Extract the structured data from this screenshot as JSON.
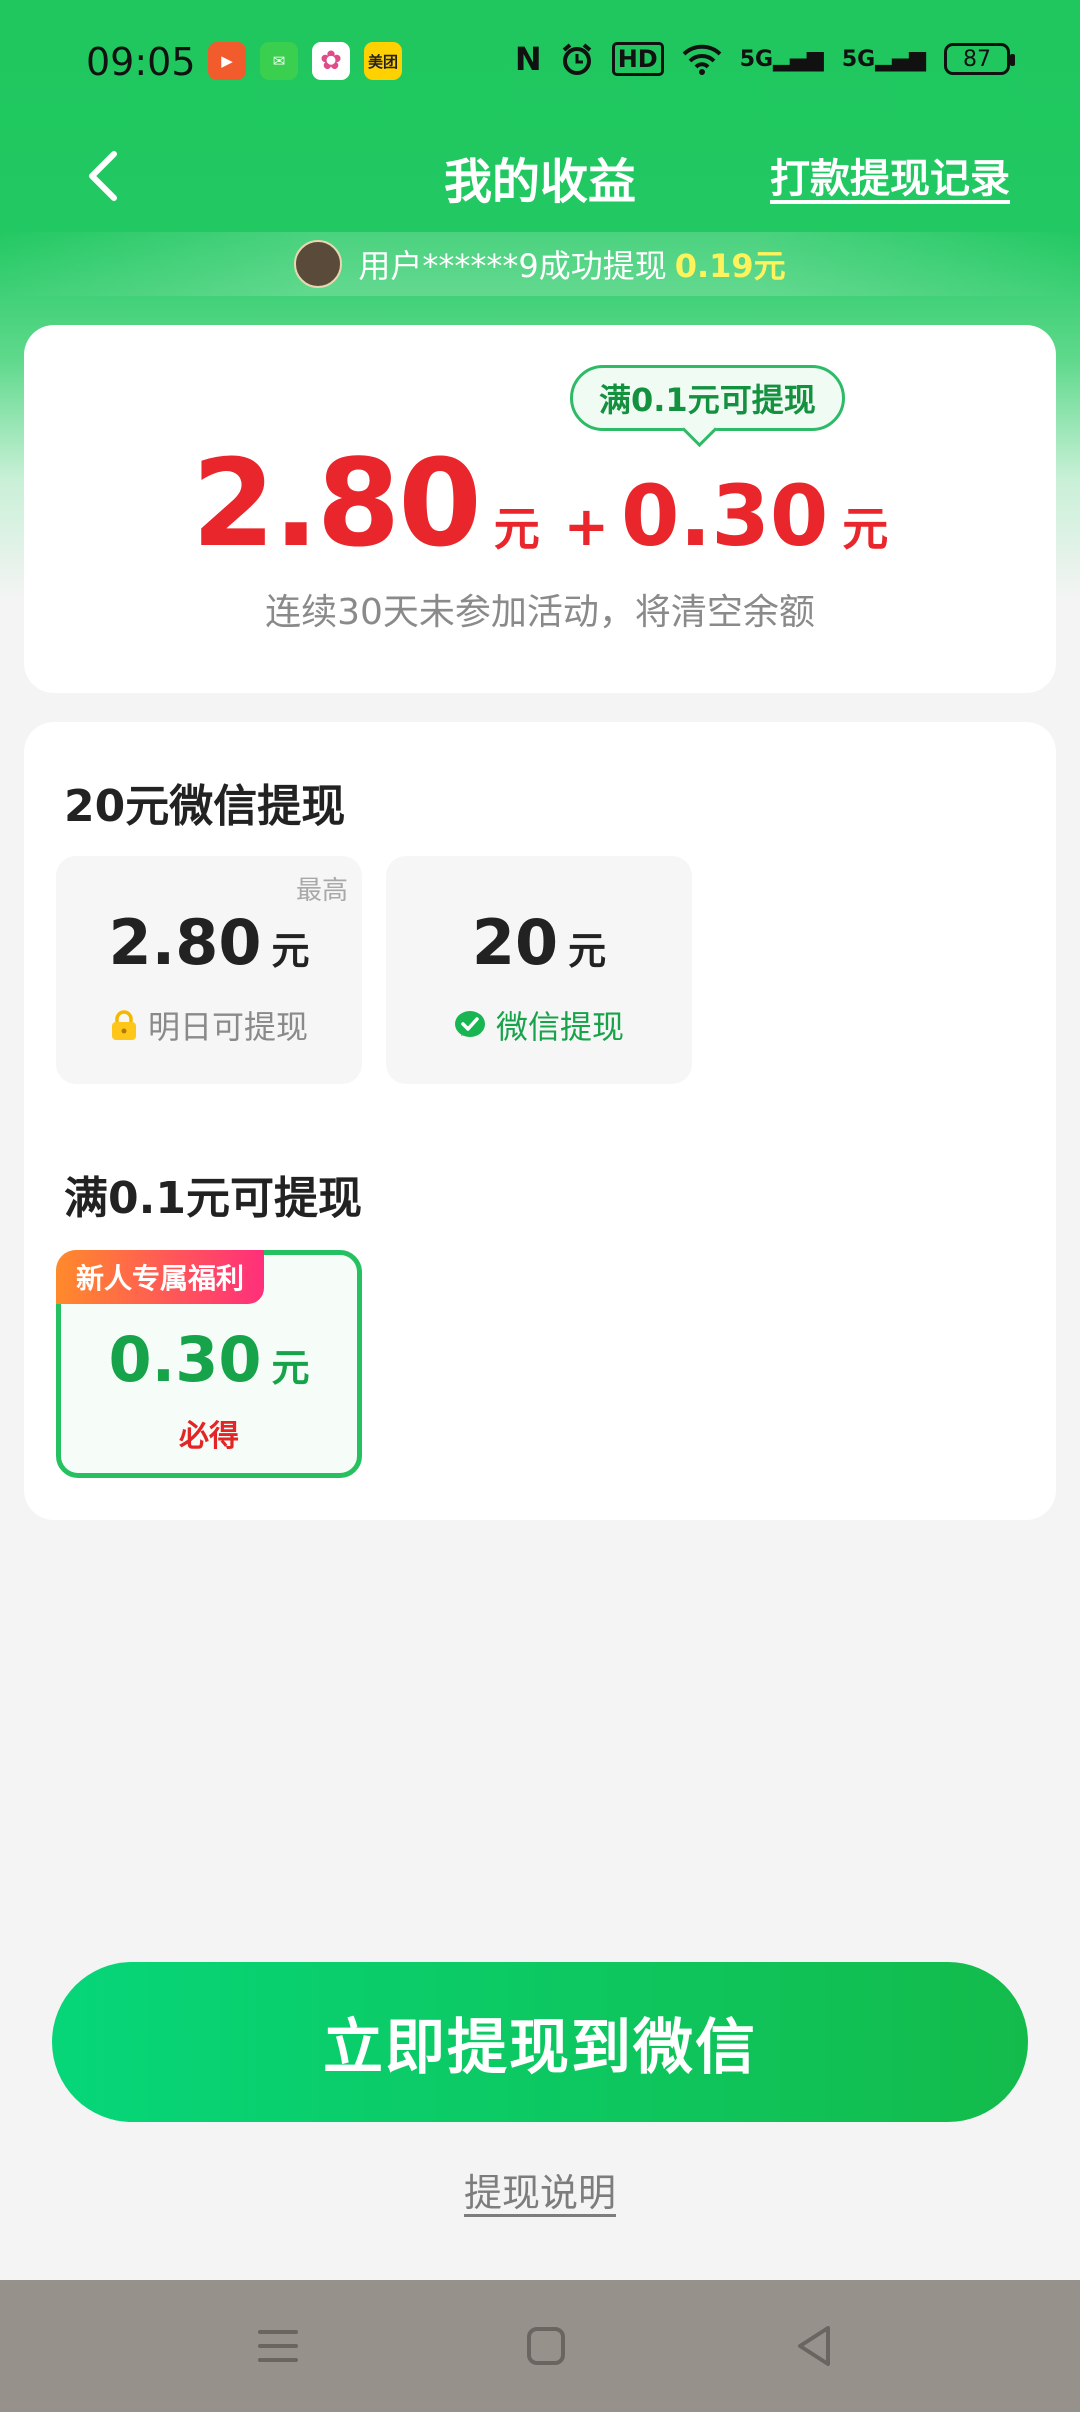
{
  "status_bar": {
    "time": "09:05",
    "app_icons": [
      {
        "name": "video-app-icon",
        "color": "#f25b2c",
        "label": "▶"
      },
      {
        "name": "message-app-icon",
        "color": "#3bcf4f",
        "label": "✉"
      },
      {
        "name": "pinwheel-app-icon",
        "color": "#ffffff",
        "label": "✿"
      },
      {
        "name": "meituan-app-icon",
        "color": "#ffd100",
        "label": "美团"
      }
    ],
    "nfc": "N",
    "hd": "HD",
    "network_1": "5G",
    "network_2": "5G",
    "battery": "87"
  },
  "header": {
    "title": "我的收益",
    "record_link": "打款提现记录"
  },
  "ticker": {
    "text": "用户******9成功提现",
    "amount": "0.19元"
  },
  "balance": {
    "tooltip": "满0.1元可提现",
    "main_amount": "2.80",
    "main_unit": "元",
    "plus": "+",
    "bonus_amount": "0.30",
    "bonus_unit": "元",
    "note": "连续30天未参加活动，将清空余额"
  },
  "withdraw": {
    "section1_title": "20元微信提现",
    "options": [
      {
        "corner": "最高",
        "amount": "2.80",
        "unit": "元",
        "sub": "明日可提现"
      },
      {
        "corner": "",
        "amount": "20",
        "unit": "元",
        "sub": "微信提现"
      }
    ],
    "section2_title": "满0.1元可提现",
    "new_option": {
      "badge": "新人专属福利",
      "amount": "0.30",
      "unit": "元",
      "sub": "必得"
    }
  },
  "cta": {
    "label": "立即提现到微信",
    "explain": "提现说明"
  },
  "colors": {
    "brand_green": "#22c862",
    "amount_red": "#e8262b",
    "accent_green": "#16a34a"
  }
}
